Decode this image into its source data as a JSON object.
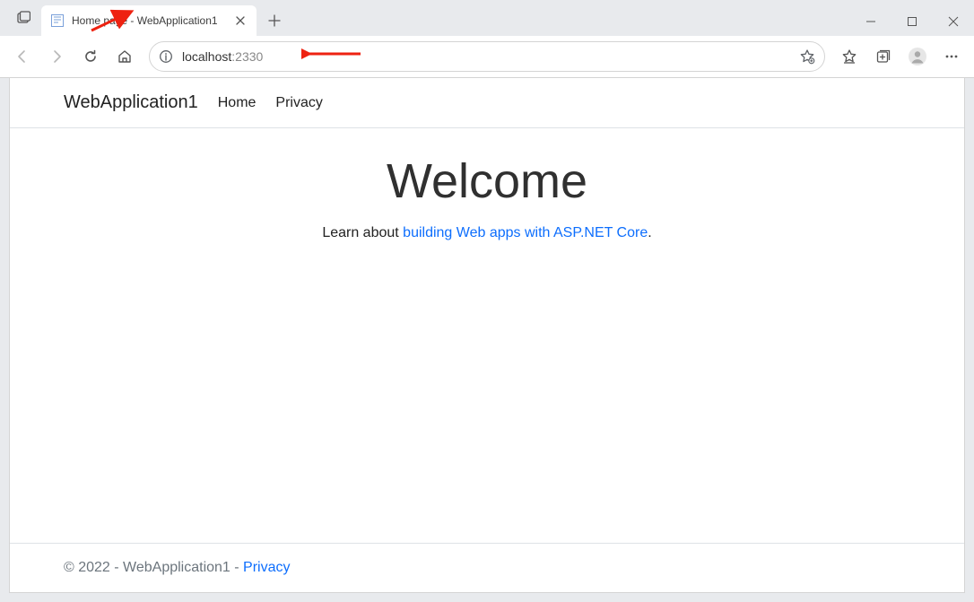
{
  "browser": {
    "tab_title": "Home page - WebApplication1",
    "url_host": "localhost",
    "url_port": ":2330"
  },
  "navbar": {
    "brand": "WebApplication1",
    "links": {
      "home": "Home",
      "privacy": "Privacy"
    }
  },
  "hero": {
    "heading": "Welcome",
    "lead_prefix": "Learn about ",
    "lead_link": "building Web apps with ASP.NET Core",
    "lead_suffix": "."
  },
  "footer": {
    "text": "© 2022 - WebApplication1 - ",
    "link": "Privacy"
  }
}
